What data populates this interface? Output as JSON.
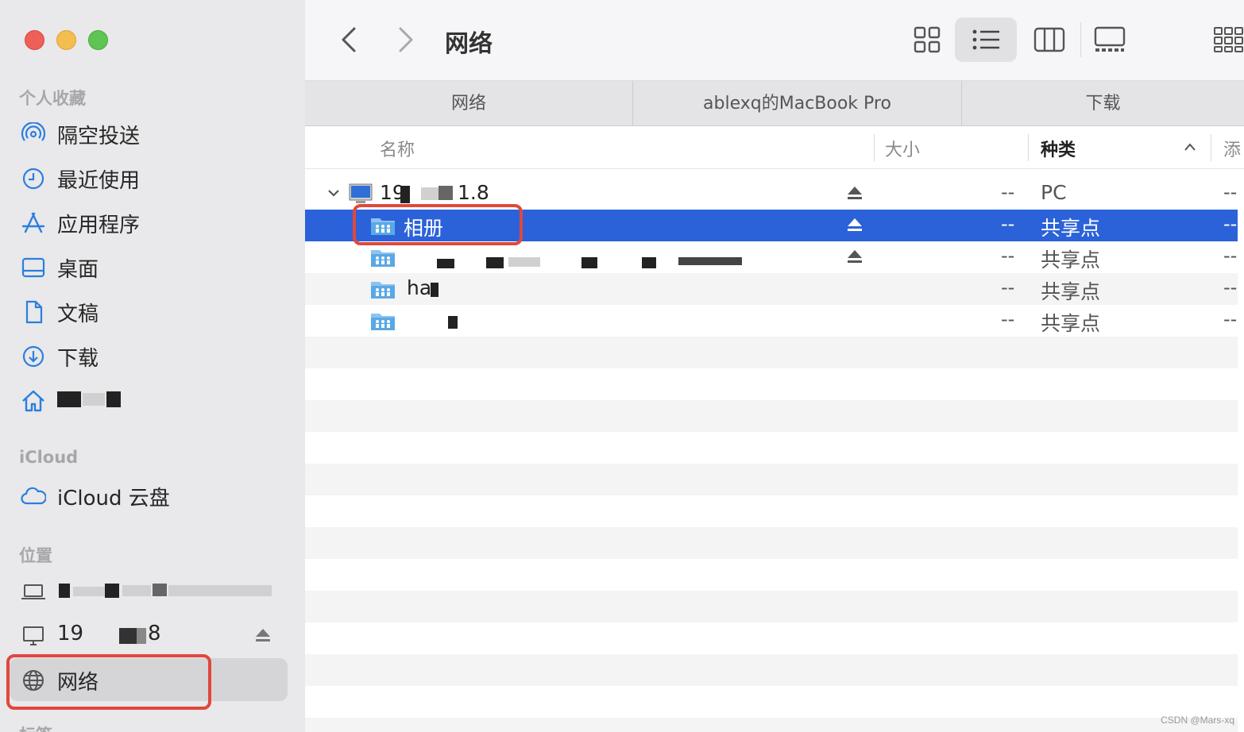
{
  "window": {
    "title": "网络"
  },
  "sidebar": {
    "favorites_title": "个人收藏",
    "favorites": [
      {
        "label": "隔空投送",
        "icon": "airdrop-icon"
      },
      {
        "label": "最近使用",
        "icon": "clock-icon"
      },
      {
        "label": "应用程序",
        "icon": "applications-icon"
      },
      {
        "label": "桌面",
        "icon": "desktop-icon"
      },
      {
        "label": "文稿",
        "icon": "document-icon"
      },
      {
        "label": "下载",
        "icon": "download-icon"
      },
      {
        "label": "",
        "icon": "home-icon"
      }
    ],
    "icloud_title": "iCloud",
    "icloud": [
      {
        "label": "iCloud 云盘",
        "icon": "cloud-icon"
      }
    ],
    "locations_title": "位置",
    "locations": [
      {
        "label": "",
        "icon": "laptop-icon"
      },
      {
        "label": "19",
        "label_suffix": "8",
        "icon": "monitor-icon"
      },
      {
        "label": "网络",
        "icon": "globe-icon"
      }
    ],
    "next_section_partial": "标签"
  },
  "toolbar": {
    "back": "back-chevron-icon",
    "forward": "forward-chevron-icon",
    "views": [
      "icon-view",
      "list-view",
      "column-view",
      "gallery-view"
    ],
    "active_view": "list-view"
  },
  "tabs": [
    {
      "label": "网络"
    },
    {
      "label": "ablexq的MacBook Pro"
    },
    {
      "label": "下载"
    }
  ],
  "columns": {
    "name": "名称",
    "size": "大小",
    "kind": "种类",
    "added": "添"
  },
  "rows": [
    {
      "name": "19",
      "name_suffix": "1.8",
      "size": "--",
      "kind": "PC",
      "added": "--",
      "level": 0,
      "icon": "pc-icon",
      "eject": true
    },
    {
      "name": "相册",
      "size": "--",
      "kind": "共享点",
      "added": "--",
      "level": 1,
      "icon": "shared-folder-icon",
      "eject": true,
      "selected": true
    },
    {
      "name": "",
      "size": "--",
      "kind": "共享点",
      "added": "--",
      "level": 1,
      "icon": "shared-folder-icon",
      "eject": true
    },
    {
      "name": "ha",
      "size": "--",
      "kind": "共享点",
      "added": "--",
      "level": 1,
      "icon": "shared-folder-icon",
      "eject": false
    },
    {
      "name": "",
      "size": "--",
      "kind": "共享点",
      "added": "--",
      "level": 1,
      "icon": "shared-folder-icon",
      "eject": false
    }
  ],
  "watermark": "CSDN @Mars-xq",
  "colors": {
    "selection": "#2b62d9",
    "annotation": "#e0483c",
    "accent": "#2a7fde"
  }
}
